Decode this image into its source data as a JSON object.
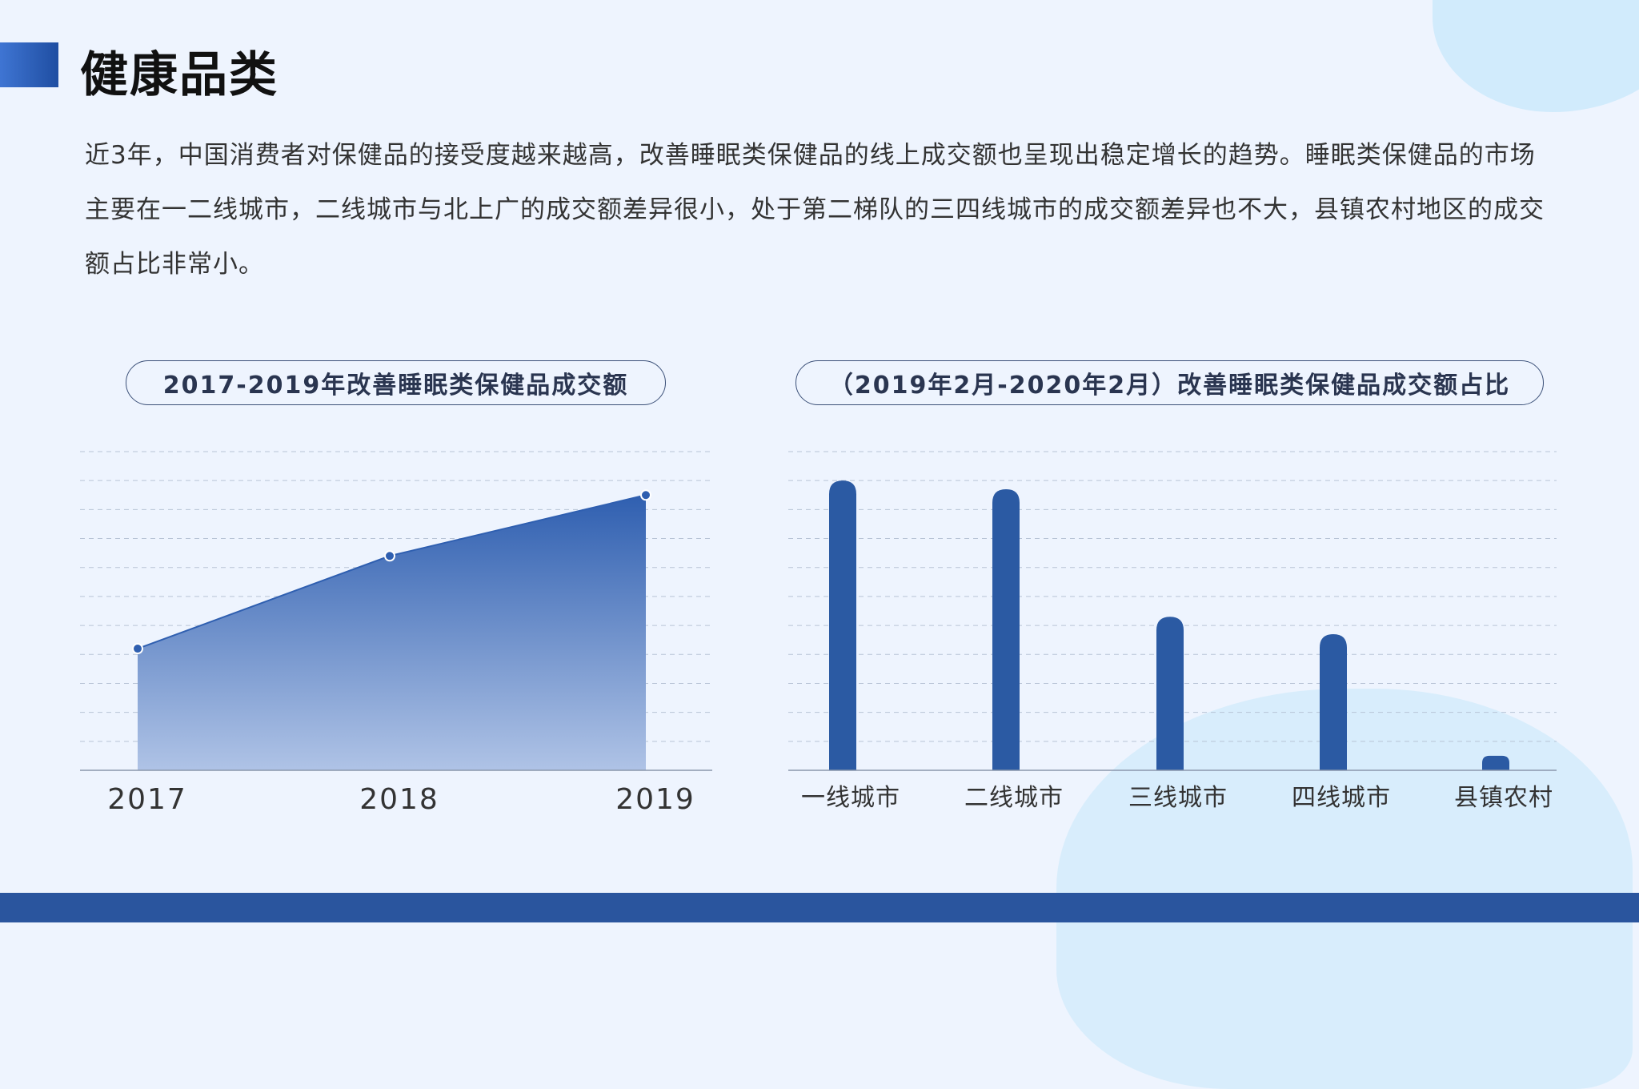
{
  "page": {
    "title": "健康品类",
    "intro": "近3年，中国消费者对保健品的接受度越来越高，改善睡眠类保健品的线上成交额也呈现出稳定增长的趋势。睡眠类保健品的市场主要在一二线城市，二线城市与北上广的成交额差异很小，处于第二梯队的三四线城市的成交额差异也不大，县镇农村地区的成交额占比非常小。"
  },
  "colors": {
    "accent": "#2a559e",
    "area_top": "#2f5fb0",
    "area_bottom": "#afc3e6",
    "bar": "#2b5aa3",
    "grid": "#b8c4d6"
  },
  "chart_data": [
    {
      "type": "area",
      "title": "2017-2019年改善睡眠类保健品成交额",
      "categories": [
        "2017",
        "2018",
        "2019"
      ],
      "series": [
        {
          "values": [
            42,
            74,
            95
          ]
        }
      ],
      "ylim": [
        0,
        110
      ],
      "grid": true
    },
    {
      "type": "bar",
      "title": "（2019年2月-2020年2月）改善睡眠类保健品成交额占比",
      "categories": [
        "一线城市",
        "二线城市",
        "三线城市",
        "四线城市",
        "县镇农村"
      ],
      "series": [
        {
          "values": [
            100,
            97,
            53,
            47,
            5
          ]
        }
      ],
      "ylim": [
        0,
        110
      ],
      "grid": true
    }
  ]
}
